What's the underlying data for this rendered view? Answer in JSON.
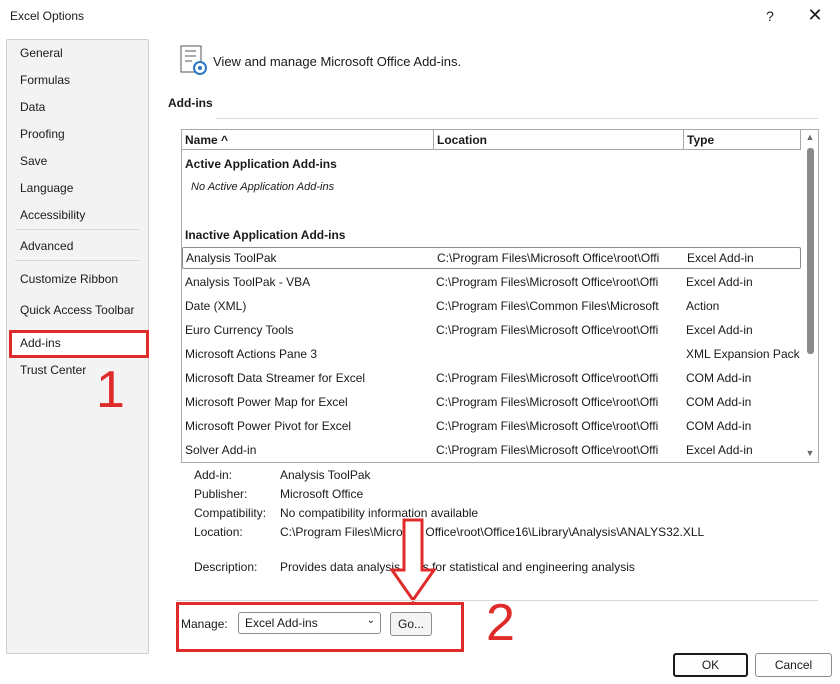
{
  "window": {
    "title": "Excel Options",
    "help_label": "?",
    "close_label": "✕"
  },
  "sidebar": {
    "items": [
      {
        "label": "General"
      },
      {
        "label": "Formulas"
      },
      {
        "label": "Data"
      },
      {
        "label": "Proofing"
      },
      {
        "label": "Save"
      },
      {
        "label": "Language"
      },
      {
        "label": "Accessibility"
      },
      {
        "label": "Advanced"
      },
      {
        "label": "Customize Ribbon"
      },
      {
        "label": "Quick Access Toolbar"
      },
      {
        "label": "Add-ins"
      },
      {
        "label": "Trust Center"
      }
    ],
    "selected": "Add-ins"
  },
  "annotations": {
    "step1": "1",
    "step2": "2",
    "accent": "#e02b2b"
  },
  "header": {
    "icon": "addins-gear-icon",
    "text": "View and manage Microsoft Office Add-ins."
  },
  "section": {
    "title": "Add-ins"
  },
  "grid": {
    "columns": {
      "name": "Name ^",
      "location": "Location",
      "type": "Type"
    },
    "groups": {
      "active": "Active Application Add-ins",
      "active_empty": "No Active Application Add-ins",
      "inactive": "Inactive Application Add-ins"
    },
    "rows": [
      {
        "name": "Analysis ToolPak",
        "location": "C:\\Program Files\\Microsoft Office\\root\\Offi",
        "type": "Excel Add-in"
      },
      {
        "name": "Analysis ToolPak - VBA",
        "location": "C:\\Program Files\\Microsoft Office\\root\\Offi",
        "type": "Excel Add-in"
      },
      {
        "name": "Date (XML)",
        "location": "C:\\Program Files\\Common Files\\Microsoft",
        "type": "Action"
      },
      {
        "name": "Euro Currency Tools",
        "location": "C:\\Program Files\\Microsoft Office\\root\\Offi",
        "type": "Excel Add-in"
      },
      {
        "name": "Microsoft Actions Pane 3",
        "location": "",
        "type": "XML Expansion Pack"
      },
      {
        "name": "Microsoft Data Streamer for Excel",
        "location": "C:\\Program Files\\Microsoft Office\\root\\Offi",
        "type": "COM Add-in"
      },
      {
        "name": "Microsoft Power Map for Excel",
        "location": "C:\\Program Files\\Microsoft Office\\root\\Offi",
        "type": "COM Add-in"
      },
      {
        "name": "Microsoft Power Pivot for Excel",
        "location": "C:\\Program Files\\Microsoft Office\\root\\Offi",
        "type": "COM Add-in"
      },
      {
        "name": "Solver Add-in",
        "location": "C:\\Program Files\\Microsoft Office\\root\\Offi",
        "type": "Excel Add-in"
      }
    ],
    "selected_row": "Analysis ToolPak"
  },
  "details": {
    "addin_label": "Add-in:",
    "addin_value": "Analysis ToolPak",
    "publisher_label": "Publisher:",
    "publisher_value": "Microsoft Office",
    "compat_label": "Compatibility:",
    "compat_value": "No compatibility information available",
    "location_label": "Location:",
    "location_value": "C:\\Program Files\\Microsoft Office\\root\\Office16\\Library\\Analysis\\ANALYS32.XLL",
    "description_label": "Description:",
    "description_value": "Provides data analysis tools for statistical and engineering analysis"
  },
  "manage": {
    "label": "Manage:",
    "selected": "Excel Add-ins",
    "go_label": "Go..."
  },
  "footer": {
    "ok_label": "OK",
    "cancel_label": "Cancel"
  }
}
